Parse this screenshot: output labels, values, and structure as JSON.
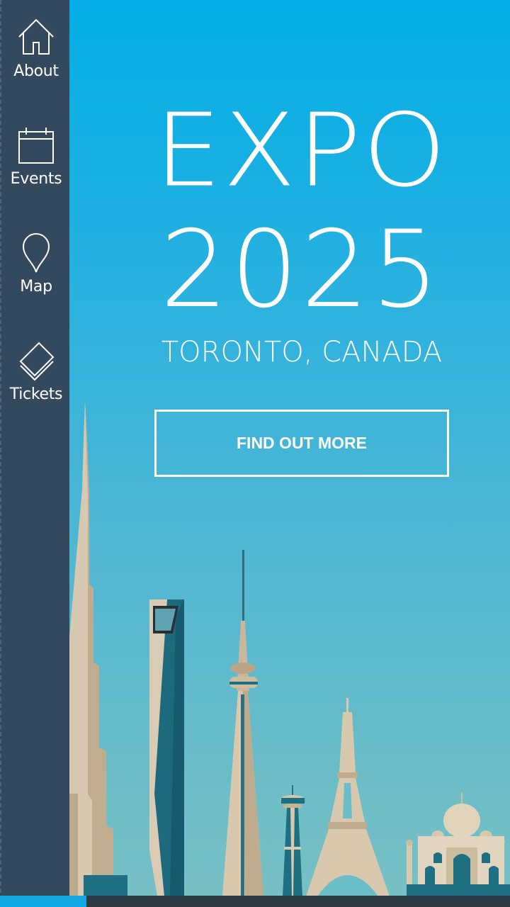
{
  "sidebar": {
    "items": [
      {
        "label": "About",
        "icon": "home-icon"
      },
      {
        "label": "Events",
        "icon": "calendar-icon"
      },
      {
        "label": "Map",
        "icon": "map-pin-icon"
      },
      {
        "label": "Tickets",
        "icon": "ticket-icon"
      }
    ]
  },
  "hero": {
    "title_line1": "EXPO",
    "title_line2": "2025",
    "location": "TORONTO, CANADA",
    "cta_label": "FIND OUT MORE"
  },
  "progress": {
    "fraction": 0.17
  },
  "colors": {
    "sidebar_bg": "#34495e",
    "sky_top": "#03aee6",
    "sky_bottom": "#78c0c4",
    "accent": "#11a7e3",
    "bottom_bar": "#2d3a44"
  }
}
